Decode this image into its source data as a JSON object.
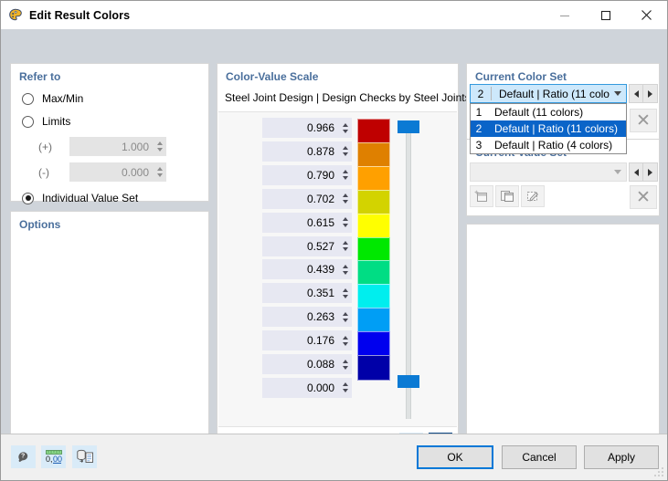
{
  "window": {
    "title": "Edit Result Colors",
    "icon": "color-palette-icon",
    "controls": {
      "minimize": "minimize-icon",
      "maximize": "maximize-icon",
      "close": "close-icon"
    }
  },
  "refer_to": {
    "title": "Refer to",
    "options": [
      {
        "label": "Max/Min",
        "checked": false
      },
      {
        "label": "Limits",
        "checked": false
      },
      {
        "label": "Individual Value Set",
        "checked": true
      }
    ],
    "limits": [
      {
        "prefix": "(+)",
        "value": "1.000",
        "enabled": false
      },
      {
        "prefix": "(-)",
        "value": "0.000",
        "enabled": false
      }
    ]
  },
  "options": {
    "title": "Options"
  },
  "color_value_scale": {
    "title": "Color-Value Scale",
    "caption": "Steel Joint Design | Design Checks by Steel Joints",
    "rows": [
      {
        "value": "0.966",
        "color": "#bf0000"
      },
      {
        "value": "0.878",
        "color": "#df8000"
      },
      {
        "value": "0.790",
        "color": "#ffa000"
      },
      {
        "value": "0.702",
        "color": "#d3d300"
      },
      {
        "value": "0.615",
        "color": "#ffff00"
      },
      {
        "value": "0.527",
        "color": "#00e800"
      },
      {
        "value": "0.439",
        "color": "#00dd84"
      },
      {
        "value": "0.351",
        "color": "#00eeee"
      },
      {
        "value": "0.263",
        "color": "#009ef5"
      },
      {
        "value": "0.176",
        "color": "#0000ee"
      },
      {
        "value": "0.088",
        "color": "#0000a8"
      },
      {
        "value": "0.000",
        "color": null
      }
    ],
    "slider": {
      "thumb_top_color": "#0b7ad4",
      "thumb_bottom_color": "#0b7ad4"
    },
    "toolbar": [
      {
        "name": "continuous-scale-button",
        "active": false
      },
      {
        "name": "stepped-scale-button",
        "active": true
      }
    ]
  },
  "current_color_set": {
    "title": "Current Color Set",
    "selected": {
      "number": "2",
      "label": "Default | Ratio (11 colors)"
    },
    "dropdown_open": true,
    "items": [
      {
        "number": "1",
        "label": "Default (11 colors)",
        "selected": false
      },
      {
        "number": "2",
        "label": "Default | Ratio (11 colors)",
        "selected": true
      },
      {
        "number": "3",
        "label": "Default | Ratio (4 colors)",
        "selected": false
      }
    ],
    "prev_label": "previous-color-set",
    "next_label": "next-color-set",
    "delete_label": "✕"
  },
  "current_value_set": {
    "title": "Current Value Set",
    "selected": "",
    "prev_label": "previous-value-set",
    "next_label": "next-value-set",
    "delete_label": "✕",
    "buttons": [
      {
        "name": "new-value-set-button"
      },
      {
        "name": "copy-value-set-button"
      },
      {
        "name": "edit-value-set-button"
      }
    ]
  },
  "footer": {
    "icons": [
      {
        "name": "help-icon"
      },
      {
        "name": "decimal-places-icon"
      },
      {
        "name": "units-icon"
      }
    ],
    "buttons": [
      {
        "label": "OK",
        "default": true
      },
      {
        "label": "Cancel",
        "default": false
      },
      {
        "label": "Apply",
        "default": false
      }
    ]
  }
}
